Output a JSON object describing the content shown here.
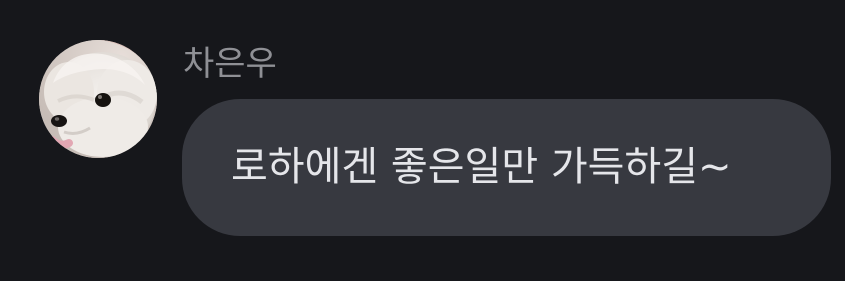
{
  "message": {
    "sender": "차은우",
    "text": "로하에겐 좋은일만 가득하길~",
    "avatar_subject": "white-dog-photo"
  },
  "colors": {
    "background": "#16171b",
    "bubble": "#373940",
    "sender_text": "#8f9095",
    "message_text": "#e5e6ea"
  }
}
